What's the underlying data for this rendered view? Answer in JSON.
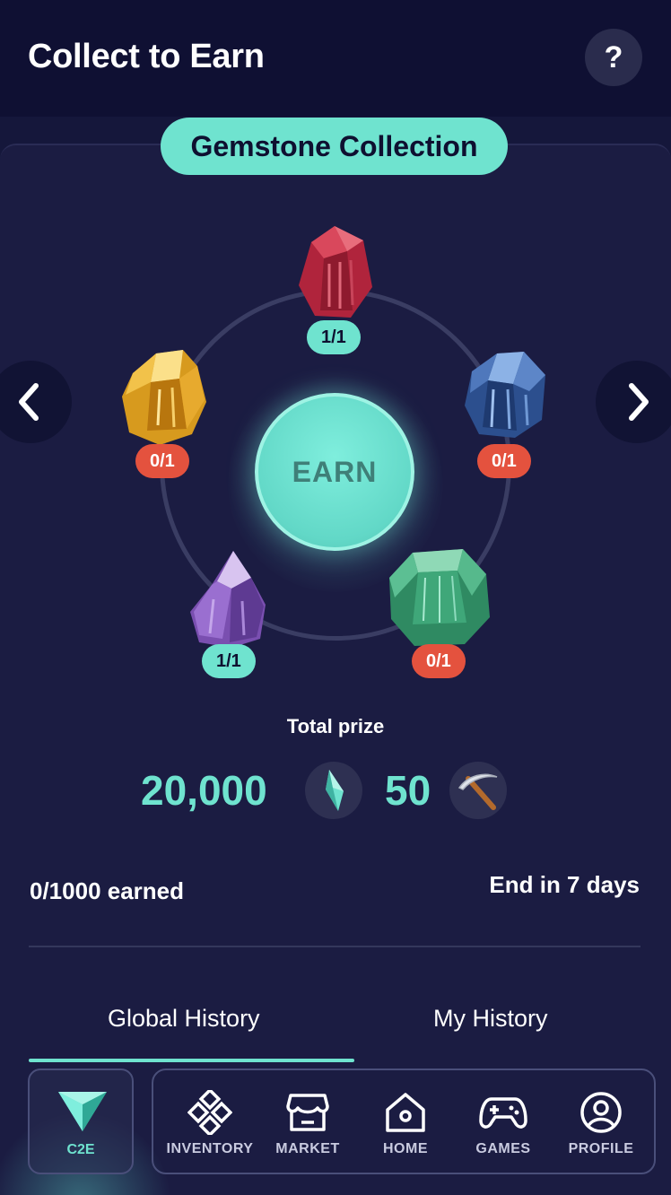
{
  "header": {
    "title": "Collect to Earn",
    "help_label": "?"
  },
  "collection": {
    "name": "Gemstone Collection",
    "earn_label": "EARN"
  },
  "gems": [
    {
      "name": "ruby",
      "count": "1/1",
      "collected": true
    },
    {
      "name": "sapphire",
      "count": "0/1",
      "collected": false
    },
    {
      "name": "emerald",
      "count": "0/1",
      "collected": false
    },
    {
      "name": "amethyst",
      "count": "1/1",
      "collected": true
    },
    {
      "name": "citrine",
      "count": "0/1",
      "collected": false
    }
  ],
  "prize": {
    "label": "Total prize",
    "crystal_amount": "20,000",
    "crystal_icon": "crystal-icon",
    "pickaxe_amount": "50",
    "pickaxe_icon": "pickaxe-icon"
  },
  "progress": {
    "earned": "0/1000 earned",
    "ends": "End in 7 days"
  },
  "tabs": [
    {
      "label": "Global History",
      "active": true
    },
    {
      "label": "My History",
      "active": false
    }
  ],
  "bottom_nav": {
    "c2e_label": "C2E",
    "items": [
      {
        "label": "INVENTORY",
        "icon": "inventory-icon"
      },
      {
        "label": "MARKET",
        "icon": "market-icon"
      },
      {
        "label": "HOME",
        "icon": "home-icon"
      },
      {
        "label": "GAMES",
        "icon": "gamepad-icon"
      },
      {
        "label": "PROFILE",
        "icon": "profile-icon"
      }
    ]
  },
  "colors": {
    "accent": "#6fe3cf",
    "alert": "#e4523e",
    "background": "#15173b"
  }
}
